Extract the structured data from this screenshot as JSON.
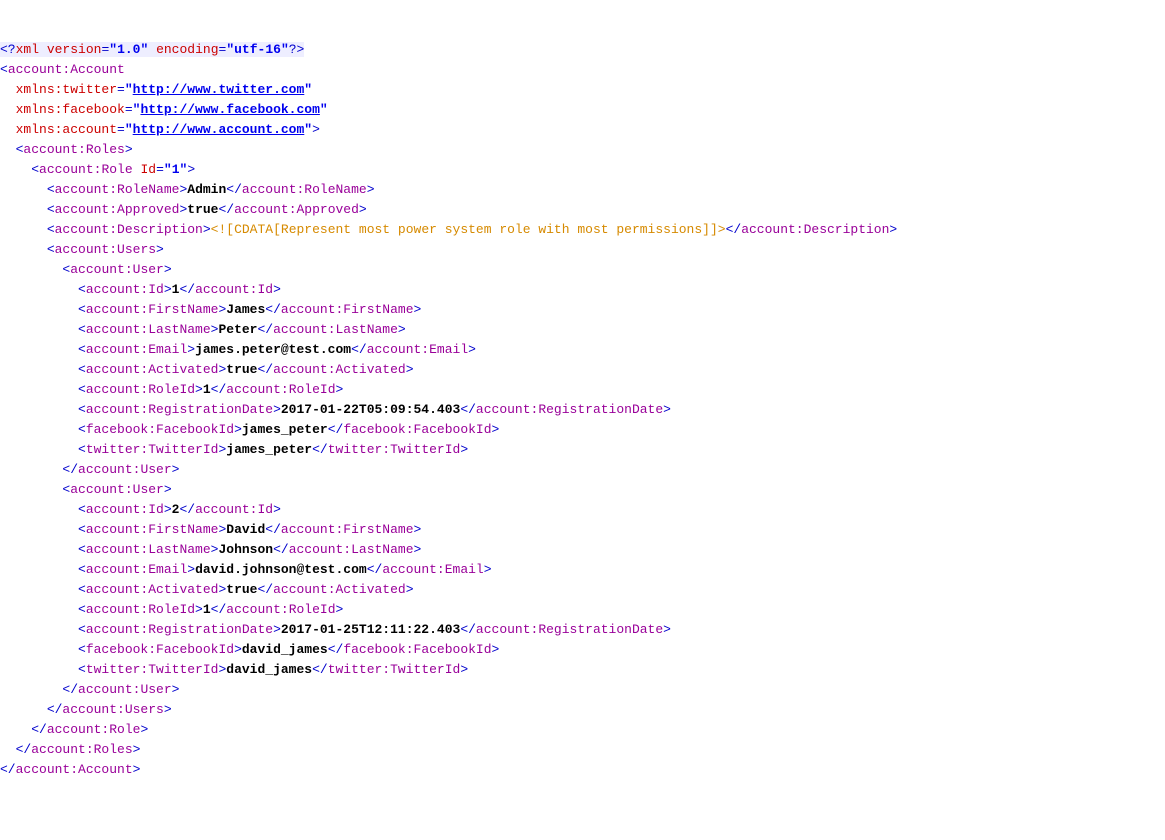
{
  "declaration": {
    "version": "1.0",
    "encoding": "utf-16"
  },
  "root_element": "account:Account",
  "namespaces": {
    "twitter_prefix": "xmlns:twitter",
    "twitter_url": "http://www.twitter.com",
    "facebook_prefix": "xmlns:facebook",
    "facebook_url": "http://www.facebook.com",
    "account_prefix": "xmlns:account",
    "account_url": "http://www.account.com"
  },
  "roles_element": "account:Roles",
  "role_element": "account:Role",
  "role_id_attr": "Id",
  "role_id_val": "1",
  "role_name_element": "account:RoleName",
  "role_name_value": "Admin",
  "approved_element": "account:Approved",
  "approved_value": "true",
  "description_element": "account:Description",
  "cdata_open": "<![CDATA[",
  "cdata_content": "Represent most power system role with most permissions",
  "cdata_close": "]]>",
  "users_element": "account:Users",
  "user_element": "account:User",
  "id_element": "account:Id",
  "firstname_element": "account:FirstName",
  "lastname_element": "account:LastName",
  "email_element": "account:Email",
  "activated_element": "account:Activated",
  "roleid_element": "account:RoleId",
  "regdate_element": "account:RegistrationDate",
  "facebookid_element": "facebook:FacebookId",
  "twitterid_element": "twitter:TwitterId",
  "users": [
    {
      "id": "1",
      "firstname": "James",
      "lastname": "Peter",
      "email": "james.peter@test.com",
      "activated": "true",
      "roleid": "1",
      "regdate": "2017-01-22T05:09:54.403",
      "facebookid": "james_peter",
      "twitterid": "james_peter"
    },
    {
      "id": "2",
      "firstname": "David",
      "lastname": "Johnson",
      "email": "david.johnson@test.com",
      "activated": "true",
      "roleid": "1",
      "regdate": "2017-01-25T12:11:22.403",
      "facebookid": "david_james",
      "twitterid": "david_james"
    }
  ]
}
